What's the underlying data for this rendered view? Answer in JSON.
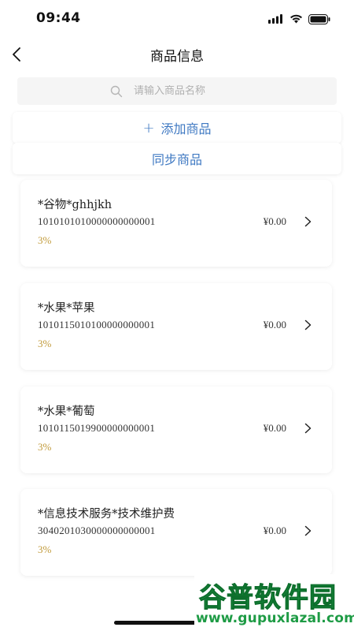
{
  "status_bar": {
    "time": "09:44"
  },
  "nav": {
    "title": "商品信息"
  },
  "search": {
    "placeholder": "请输入商品名称"
  },
  "actions": {
    "add_label": "添加商品",
    "add_icon": "+",
    "sync_label": "同步商品"
  },
  "products": [
    {
      "name": "*谷物*ghhjkh",
      "code": "1010101010000000000001",
      "price": "¥0.00",
      "rate": "3%"
    },
    {
      "name": "*水果*苹果",
      "code": "1010115010100000000001",
      "price": "¥0.00",
      "rate": "3%"
    },
    {
      "name": "*水果*葡萄",
      "code": "1010115019900000000001",
      "price": "¥0.00",
      "rate": "3%"
    },
    {
      "name": "*信息技术服务*技术维护费",
      "code": "3040201030000000000001",
      "price": "¥0.00",
      "rate": "3%"
    }
  ],
  "watermark": {
    "text": "谷普软件园",
    "url": "www.gupuxlazal.com"
  },
  "colors": {
    "accent": "#3e78c2",
    "rate": "#c19a3a",
    "watermark": "#1e9b45"
  }
}
